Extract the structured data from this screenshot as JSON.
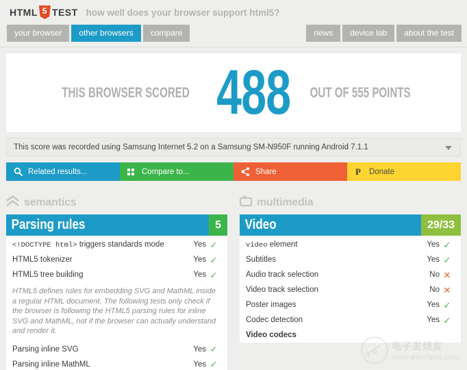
{
  "header": {
    "logo": {
      "prefix": "HTML",
      "shield": "5",
      "suffix": "TEST"
    },
    "tagline": "how well does your browser support html5?",
    "nav_left": [
      {
        "label": "your browser",
        "active": false
      },
      {
        "label": "other browsers",
        "active": true
      },
      {
        "label": "compare",
        "active": false
      }
    ],
    "nav_right": [
      {
        "label": "news"
      },
      {
        "label": "device lab"
      },
      {
        "label": "about the test"
      }
    ]
  },
  "score": {
    "prefix": "THIS BROWSER SCORED",
    "value": "488",
    "suffix": "OUT OF 555 POINTS",
    "accent_color": "#1d9bc7",
    "label_color": "#b0b0ae"
  },
  "info": {
    "text": "This score was recorded using Samsung Internet 5.2 on a Samsung SM-N950F running Android 7.1.1",
    "caret_icon": "chevron-down-icon"
  },
  "actions": [
    {
      "label": "Related results...",
      "icon": "search-icon",
      "color": "#1d9bc7"
    },
    {
      "label": "Compare to...",
      "icon": "grid-icon",
      "color": "#3bb54a"
    },
    {
      "label": "Share",
      "icon": "share-icon",
      "color": "#ef6036"
    },
    {
      "label": "Donate",
      "icon": "paypal-icon",
      "color": "#fdd430"
    }
  ],
  "columns": [
    {
      "category": {
        "label": "semantics",
        "icon": "double-chevron-up-icon"
      },
      "section": {
        "title": "Parsing rules",
        "score": "5",
        "score_style": "full",
        "rows": [
          {
            "type": "test",
            "label": "<!DOCTYPE html> triggers standards mode",
            "mono_prefix": "<!DOCTYPE html>",
            "plain_suffix": " triggers standards mode",
            "value": "Yes",
            "mark": "yes"
          },
          {
            "type": "test",
            "label": "HTML5 tokenizer",
            "value": "Yes",
            "mark": "yes"
          },
          {
            "type": "test",
            "label": "HTML5 tree building",
            "value": "Yes",
            "mark": "yes"
          },
          {
            "type": "note",
            "label": "HTML5 defines rules for embedding SVG and MathML inside a regular HTML document. The following tests only check if the browser is following the HTML5 parsing rules for inline SVG and MathML, not if the browser can actually understand and render it."
          },
          {
            "type": "test",
            "label": "Parsing inline SVG",
            "value": "Yes",
            "mark": "yes"
          },
          {
            "type": "test",
            "label": "Parsing inline MathML",
            "value": "Yes",
            "mark": "yes"
          }
        ]
      }
    },
    {
      "category": {
        "label": "multimedia",
        "icon": "tv-screen-icon"
      },
      "section": {
        "title": "Video",
        "score": "29/33",
        "score_style": "partial",
        "rows": [
          {
            "type": "test",
            "label": "video element",
            "mono_prefix": "video",
            "plain_suffix": " element",
            "value": "Yes",
            "mark": "yes"
          },
          {
            "type": "test",
            "label": "Subtitles",
            "value": "Yes",
            "mark": "yes"
          },
          {
            "type": "test",
            "label": "Audio track selection",
            "value": "No",
            "mark": "no"
          },
          {
            "type": "test",
            "label": "Video track selection",
            "value": "No",
            "mark": "no"
          },
          {
            "type": "test",
            "label": "Poster images",
            "value": "Yes",
            "mark": "yes"
          },
          {
            "type": "test",
            "label": "Codec detection",
            "value": "Yes",
            "mark": "yes"
          },
          {
            "type": "heading",
            "label": "Video codecs"
          }
        ]
      }
    }
  ],
  "watermark": {
    "cn": "电子发烧友",
    "en": "www.elecfans.com"
  },
  "marks": {
    "yes": "✓",
    "no": "✕"
  }
}
